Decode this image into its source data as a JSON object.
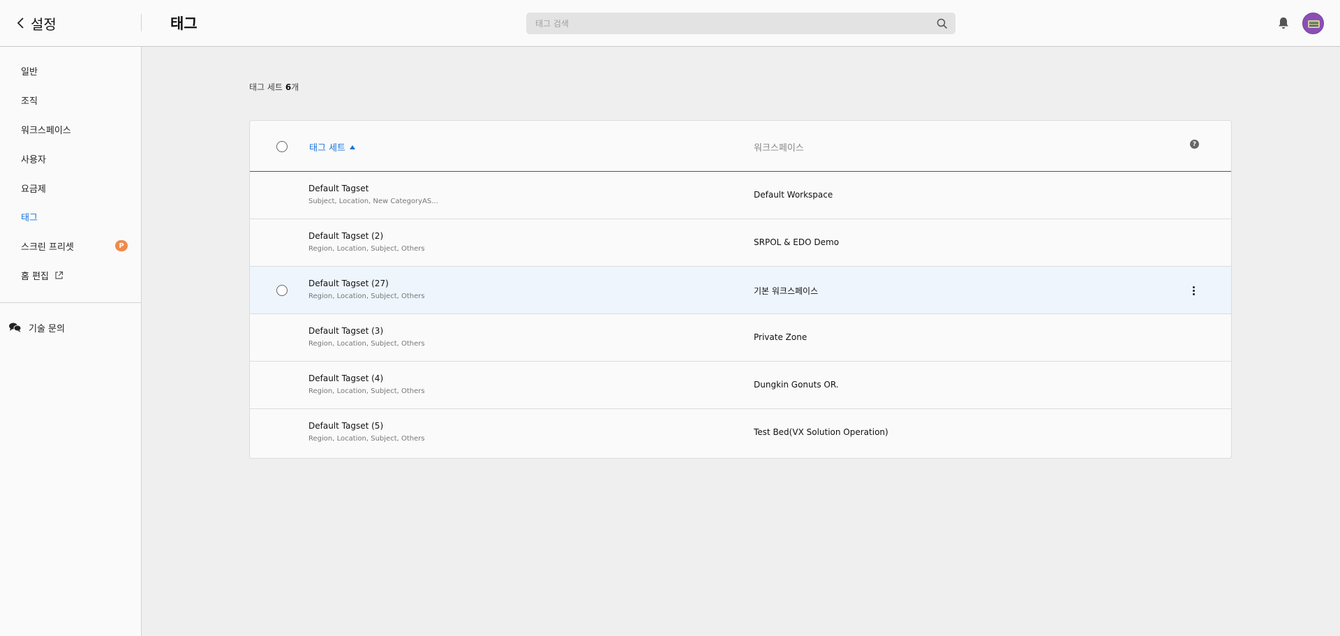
{
  "header": {
    "back_label": "설정",
    "title": "태그",
    "search_placeholder": "태그 검색"
  },
  "sidebar": {
    "items": [
      {
        "label": "일반"
      },
      {
        "label": "조직"
      },
      {
        "label": "워크스페이스"
      },
      {
        "label": "사용자"
      },
      {
        "label": "요금제"
      },
      {
        "label": "태그",
        "active": true
      },
      {
        "label": "스크린 프리셋",
        "badge": "P"
      },
      {
        "label": "홈 편집",
        "icon": "external-link-icon"
      }
    ],
    "support_label": "기술 문의"
  },
  "main": {
    "count_prefix": "태그 세트",
    "count_value": "6",
    "count_suffix": "개",
    "table": {
      "col_name": "태그 세트",
      "col_workspace": "워크스페이스",
      "help_glyph": "?",
      "rows": [
        {
          "name": "Default Tagset",
          "tags": "Subject, Location, New CategoryAS...",
          "workspace": "Default Workspace"
        },
        {
          "name": "Default Tagset (2)",
          "tags": "Region, Location, Subject, Others",
          "workspace": "SRPOL & EDO Demo"
        },
        {
          "name": "Default Tagset (27)",
          "tags": "Region, Location, Subject, Others",
          "workspace": "기본 워크스페이스"
        },
        {
          "name": "Default Tagset (3)",
          "tags": "Region, Location, Subject, Others",
          "workspace": "Private Zone"
        },
        {
          "name": "Default Tagset (4)",
          "tags": "Region, Location, Subject, Others",
          "workspace": "Dungkin Gonuts OR."
        },
        {
          "name": "Default Tagset (5)",
          "tags": "Region, Location, Subject, Others",
          "workspace": "Test Bed(VX Solution Operation)"
        }
      ]
    }
  },
  "colors": {
    "accent": "#1a73d9",
    "badge": "#f08a4b",
    "row_highlight": "#eef5fd"
  }
}
